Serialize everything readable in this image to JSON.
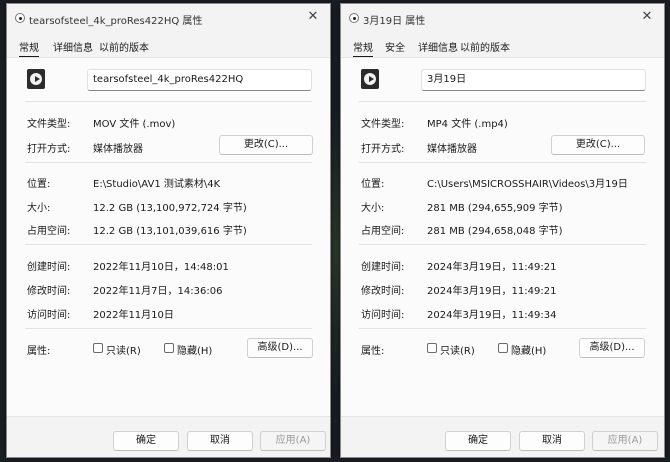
{
  "left": {
    "title": "tearsofsteel_4k_proRes422HQ 属性",
    "tabs": [
      "常规",
      "详细信息",
      "以前的版本"
    ],
    "filename": "tearsofsteel_4k_proRes422HQ",
    "type_label": "文件类型:",
    "type_value": "MOV 文件 (.mov)",
    "open_label": "打开方式:",
    "open_value": "媒体播放器",
    "change_btn": "更改(C)...",
    "location_label": "位置:",
    "location_value": "E:\\Studio\\AV1 测试素材\\4K",
    "size_label": "大小:",
    "size_value": "12.2 GB (13,100,972,724 字节)",
    "disk_label": "占用空间:",
    "disk_value": "12.2 GB (13,101,039,616 字节)",
    "created_label": "创建时间:",
    "created_value": "2022年11月10日，14:48:01",
    "modified_label": "修改时间:",
    "modified_value": "2022年11月7日，14:36:06",
    "accessed_label": "访问时间:",
    "accessed_value": "2022年11月10日",
    "attr_label": "属性:",
    "readonly_label": "只读(R)",
    "hidden_label": "隐藏(H)",
    "advanced_btn": "高级(D)...",
    "ok_btn": "确定",
    "cancel_btn": "取消",
    "apply_btn": "应用(A)"
  },
  "right": {
    "title": "3月19日 属性",
    "tabs": [
      "常规",
      "安全",
      "详细信息",
      "以前的版本"
    ],
    "filename": "3月19日",
    "type_label": "文件类型:",
    "type_value": "MP4 文件 (.mp4)",
    "open_label": "打开方式:",
    "open_value": "媒体播放器",
    "change_btn": "更改(C)...",
    "location_label": "位置:",
    "location_value": "C:\\Users\\MSICROSSHAIR\\Videos\\3月19日",
    "size_label": "大小:",
    "size_value": "281 MB (294,655,909 字节)",
    "disk_label": "占用空间:",
    "disk_value": "281 MB (294,658,048 字节)",
    "created_label": "创建时间:",
    "created_value": "2024年3月19日，11:49:21",
    "modified_label": "修改时间:",
    "modified_value": "2024年3月19日，11:49:21",
    "accessed_label": "访问时间:",
    "accessed_value": "2024年3月19日，11:49:34",
    "attr_label": "属性:",
    "readonly_label": "只读(R)",
    "hidden_label": "隐藏(H)",
    "advanced_btn": "高级(D)...",
    "ok_btn": "确定",
    "cancel_btn": "取消",
    "apply_btn": "应用(A)"
  },
  "icons": {
    "close": "close-icon",
    "title": "media-file-icon",
    "file": "media-player-file-icon"
  }
}
